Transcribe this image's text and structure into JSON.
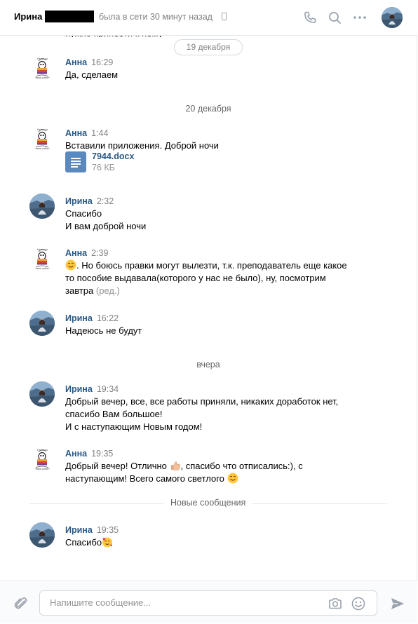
{
  "header": {
    "contact_name": "Ирина",
    "status": "была в сети 30 минут назад",
    "icons": [
      "phone-icon",
      "search-icon",
      "more-icon",
      "avatar"
    ]
  },
  "history": {
    "cut_off_text": "нужно принести к нему"
  },
  "dates": {
    "dec19": "19 декабря",
    "dec20": "20 декабря",
    "yesterday": "вчера"
  },
  "messages": [
    {
      "author": "Анна",
      "time": "16:29",
      "lines": [
        "Да, сделаем"
      ]
    },
    {
      "author": "Анна",
      "time": "1:44",
      "lines": [
        "Вставили приложения. Доброй ночи"
      ],
      "file": {
        "name": "7944.docx",
        "size": "76 КБ"
      }
    },
    {
      "author": "Ирина",
      "time": "2:32",
      "lines": [
        "Спасибо",
        "И вам доброй ночи"
      ]
    },
    {
      "author": "Анна",
      "time": "2:39",
      "lines": [
        ". Но боюсь правки могут вылезти, т.к. преподаватель еще какое",
        "то пособие выдавала(которого у нас не было), ну, посмотрим",
        "завтра"
      ],
      "edited": "(ред.)"
    },
    {
      "author": "Ирина",
      "time": "16:22",
      "lines": [
        "Надеюсь не будут"
      ]
    },
    {
      "author": "Ирина",
      "time": "19:34",
      "lines": [
        "Добрый вечер, все, все работы приняли, никаких доработок нет,",
        "спасибо Вам большое!",
        "И с наступающим Новым годом!"
      ]
    },
    {
      "author": "Анна",
      "time": "19:35",
      "lines": [
        "Добрый вечер! Отлично",
        ", спасибо что отписались:), с",
        "наступающим! Всего самого светлого"
      ]
    },
    {
      "author": "Ирина",
      "time": "19:35",
      "lines": [
        "Спасибо"
      ]
    }
  ],
  "new_messages_label": "Новые сообщения",
  "composer": {
    "placeholder": "Напишите сообщение..."
  },
  "colors": {
    "author": "#2a5885",
    "muted": "#828282",
    "file_icon": "#5b88bd",
    "border": "#e7e8ec"
  }
}
